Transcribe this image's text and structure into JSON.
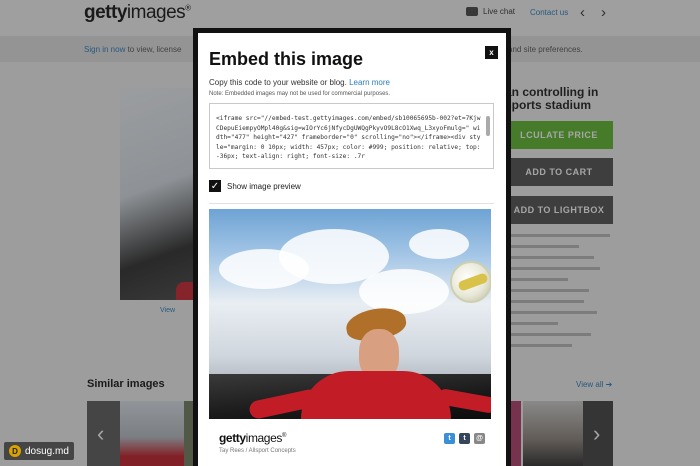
{
  "site": {
    "logo_bold": "getty",
    "logo_light": "images",
    "logo_mark": "®",
    "chat_label": "Live chat",
    "contact_label": "Contact us",
    "nav_prev": "‹",
    "nav_next": "›",
    "signbar_link": "Sign in now",
    "signbar_text": " to view, license",
    "signbar_right": "and site preferences.",
    "right_title": "an controlling in sports stadium",
    "calc_price": "LCULATE PRICE",
    "add_to_cart": "ADD TO CART",
    "add_to_lightbox": "ADD TO LIGHTBOX",
    "view_link": "View",
    "similar_title": "Similar images",
    "view_all": "View all ➔",
    "thumb_prev": "‹",
    "thumb_next": "›"
  },
  "modal": {
    "title": "Embed this image",
    "close": "x",
    "copy_text": "Copy this code to your website or blog. ",
    "learn_more": "Learn more",
    "note": "Note: Embedded images may not be used for commercial purposes.",
    "embed_code": "<iframe src=\"//embed-test.gettyimages.com/embed/sb10065695b-002?et=7KjwCDepuEiempyOMpl40g&sig=wIOrYc6jNfycDgUWQgPkyvO9L8cO1Xwq_L3xyoFmulg=\" width=\"477\" height=\"427\" frameborder=\"0\" scrolling=\"no\"></iframe><div style=\"margin: 0 10px; width: 457px; color: #999; position: relative; top: -36px; text-align: right; font-size: .7r",
    "show_preview_label": "Show image preview",
    "checkbox_mark": "✓",
    "footer_logo_bold": "getty",
    "footer_logo_light": "images",
    "footer_logo_mark": "®",
    "credit": "Tay Rees / Allsport Concepts",
    "share_twitter": "t",
    "share_tumblr": "t",
    "share_email": "@"
  },
  "watermark": {
    "icon": "D",
    "text": "dosug.md"
  },
  "colors": {
    "accent_green": "#5cb82a",
    "link_blue": "#2a7bbf",
    "shirt_red": "#c21d27"
  }
}
